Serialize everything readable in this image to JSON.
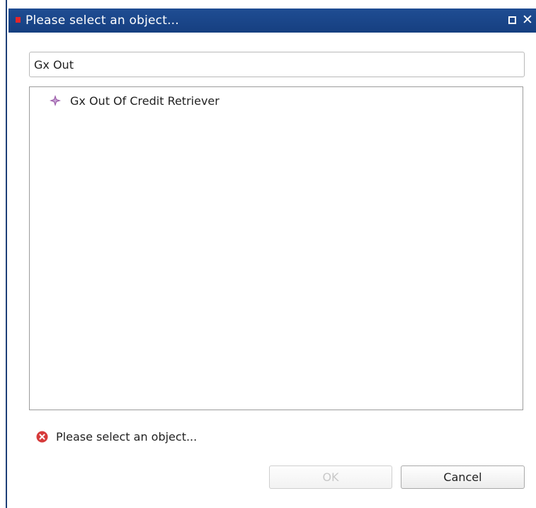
{
  "dialog": {
    "title": "Please select an object...",
    "maximize_icon": "maximize-icon",
    "close_icon": "close-icon",
    "close_glyph": "✕"
  },
  "filter": {
    "value": "Gx Out"
  },
  "results": {
    "items": [
      {
        "label": "Gx Out Of Credit Retriever",
        "icon": "sparkle-icon"
      }
    ]
  },
  "status": {
    "message": "Please select an object...",
    "icon": "error-icon"
  },
  "buttons": {
    "ok_label": "OK",
    "cancel_label": "Cancel"
  },
  "colors": {
    "title_bar": "#1f4d93",
    "title_marker": "#e3262b",
    "error": "#d63a3a",
    "item_icon": "#8a3f9a"
  }
}
